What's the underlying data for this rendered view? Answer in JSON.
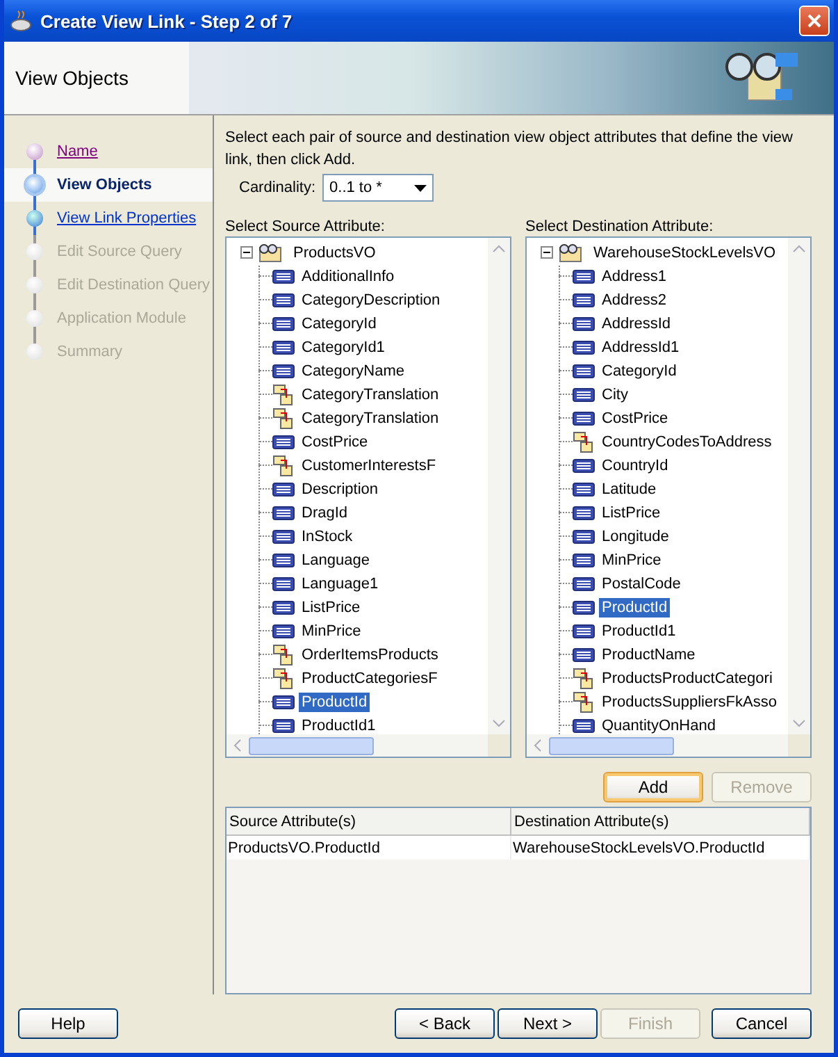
{
  "window": {
    "title": "Create View Link - Step 2 of 7"
  },
  "header": {
    "title": "View Objects"
  },
  "steps": [
    {
      "label": "Name",
      "visited": true,
      "selected": false,
      "disabled": false
    },
    {
      "label": "View Objects",
      "visited": false,
      "selected": true,
      "disabled": false
    },
    {
      "label": "View Link Properties",
      "visited": false,
      "selected": false,
      "disabled": false
    },
    {
      "label": "Edit Source Query",
      "visited": false,
      "selected": false,
      "disabled": true
    },
    {
      "label": "Edit Destination Query",
      "visited": false,
      "selected": false,
      "disabled": true
    },
    {
      "label": "Application Module",
      "visited": false,
      "selected": false,
      "disabled": true
    },
    {
      "label": "Summary",
      "visited": false,
      "selected": false,
      "disabled": true
    }
  ],
  "instructions": "Select each pair of source and destination view object attributes that define the view link, then click Add.",
  "cardinality": {
    "label": "Cardinality:",
    "value": "0..1 to *"
  },
  "source": {
    "label": "Select Source Attribute:",
    "root": {
      "label": "ProductsVO",
      "expanded": true,
      "children": [
        {
          "label": "AdditionalInfo",
          "kind": "attribute",
          "selected": false
        },
        {
          "label": "CategoryDescription",
          "kind": "attribute",
          "selected": false
        },
        {
          "label": "CategoryId",
          "kind": "attribute",
          "selected": false
        },
        {
          "label": "CategoryId1",
          "kind": "attribute",
          "selected": false
        },
        {
          "label": "CategoryName",
          "kind": "attribute",
          "selected": false
        },
        {
          "label": "CategoryTranslation",
          "kind": "association",
          "selected": false
        },
        {
          "label": "CategoryTranslation",
          "kind": "association",
          "selected": false
        },
        {
          "label": "CostPrice",
          "kind": "attribute",
          "selected": false
        },
        {
          "label": "CustomerInterestsF",
          "kind": "association",
          "selected": false
        },
        {
          "label": "Description",
          "kind": "attribute",
          "selected": false
        },
        {
          "label": "DragId",
          "kind": "attribute",
          "selected": false
        },
        {
          "label": "InStock",
          "kind": "attribute",
          "selected": false
        },
        {
          "label": "Language",
          "kind": "attribute",
          "selected": false
        },
        {
          "label": "Language1",
          "kind": "attribute",
          "selected": false
        },
        {
          "label": "ListPrice",
          "kind": "attribute",
          "selected": false
        },
        {
          "label": "MinPrice",
          "kind": "attribute",
          "selected": false
        },
        {
          "label": "OrderItemsProducts",
          "kind": "association",
          "selected": false
        },
        {
          "label": "ProductCategoriesF",
          "kind": "association",
          "selected": false
        },
        {
          "label": "ProductId",
          "kind": "attribute",
          "selected": true
        },
        {
          "label": "ProductId1",
          "kind": "attribute",
          "selected": false
        }
      ]
    }
  },
  "destination": {
    "label": "Select Destination Attribute:",
    "root": {
      "label": "WarehouseStockLevelsVO",
      "expanded": true,
      "children": [
        {
          "label": "Address1",
          "kind": "attribute",
          "selected": false
        },
        {
          "label": "Address2",
          "kind": "attribute",
          "selected": false
        },
        {
          "label": "AddressId",
          "kind": "attribute",
          "selected": false
        },
        {
          "label": "AddressId1",
          "kind": "attribute",
          "selected": false
        },
        {
          "label": "CategoryId",
          "kind": "attribute",
          "selected": false
        },
        {
          "label": "City",
          "kind": "attribute",
          "selected": false
        },
        {
          "label": "CostPrice",
          "kind": "attribute",
          "selected": false
        },
        {
          "label": "CountryCodesToAddress",
          "kind": "association",
          "selected": false
        },
        {
          "label": "CountryId",
          "kind": "attribute",
          "selected": false
        },
        {
          "label": "Latitude",
          "kind": "attribute",
          "selected": false
        },
        {
          "label": "ListPrice",
          "kind": "attribute",
          "selected": false
        },
        {
          "label": "Longitude",
          "kind": "attribute",
          "selected": false
        },
        {
          "label": "MinPrice",
          "kind": "attribute",
          "selected": false
        },
        {
          "label": "PostalCode",
          "kind": "attribute",
          "selected": false
        },
        {
          "label": "ProductId",
          "kind": "attribute",
          "selected": true
        },
        {
          "label": "ProductId1",
          "kind": "attribute",
          "selected": false
        },
        {
          "label": "ProductName",
          "kind": "attribute",
          "selected": false
        },
        {
          "label": "ProductsProductCategori",
          "kind": "association",
          "selected": false
        },
        {
          "label": "ProductsSuppliersFkAsso",
          "kind": "association",
          "selected": false
        },
        {
          "label": "QuantityOnHand",
          "kind": "attribute",
          "selected": false
        }
      ]
    }
  },
  "pair_buttons": [
    {
      "label": "Add",
      "default": true,
      "disabled": false
    },
    {
      "label": "Remove",
      "default": false,
      "disabled": true
    }
  ],
  "table": {
    "columns": [
      "Source Attribute(s)",
      "Destination Attribute(s)"
    ],
    "rows": [
      [
        "ProductsVO.ProductId",
        "WarehouseStockLevelsVO.ProductId"
      ]
    ]
  },
  "help_button": {
    "label": "Help"
  },
  "nav_buttons": [
    {
      "label": "< Back",
      "disabled": false
    },
    {
      "label": "Next >",
      "disabled": false
    },
    {
      "label": "Finish",
      "disabled": true
    },
    {
      "label": "Cancel",
      "disabled": false
    }
  ]
}
